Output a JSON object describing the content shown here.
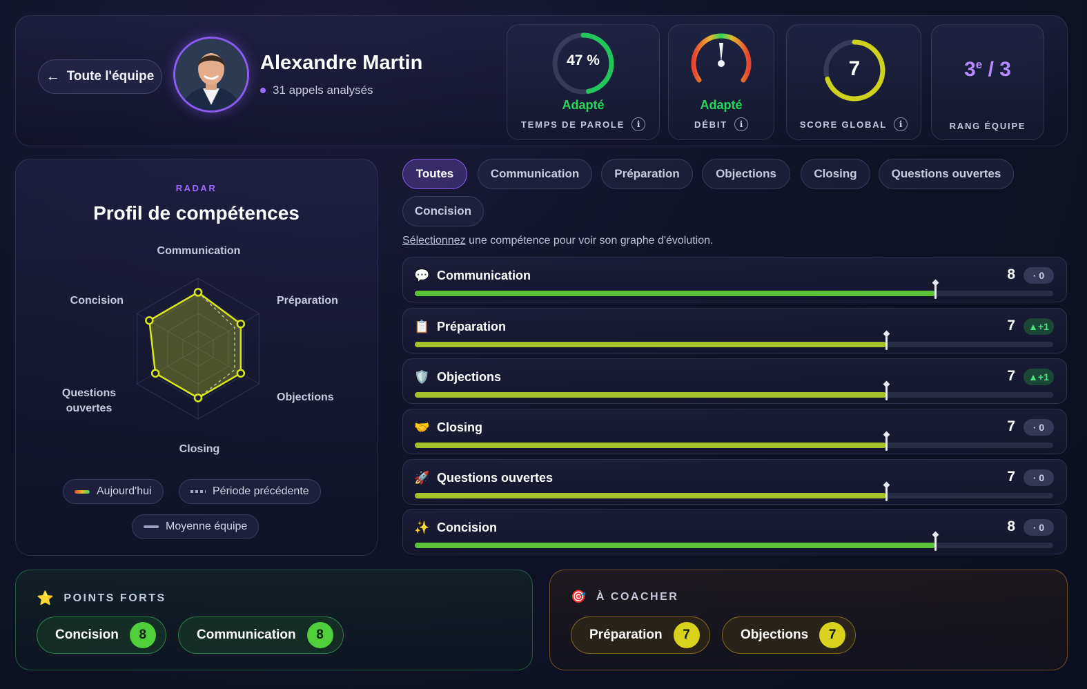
{
  "header": {
    "back_label": "Toute l'équipe",
    "name": "Alexandre Martin",
    "calls": "31 appels analysés"
  },
  "stats": {
    "talk_time": {
      "value": "47 %",
      "fraction": 0.47,
      "status": "Adapté",
      "label": "TEMPS DE PAROLE"
    },
    "debit": {
      "status": "Adapté",
      "label": "DÉBIT"
    },
    "score": {
      "value": "7",
      "fraction": 0.7,
      "label": "SCORE GLOBAL"
    },
    "rank": {
      "value": "3",
      "sup": "e",
      "total": "/ 3",
      "label": "RANG ÉQUIPE"
    }
  },
  "radar": {
    "kicker": "RADAR",
    "title": "Profil de compétences",
    "axes": [
      "Communication",
      "Préparation",
      "Objections",
      "Closing",
      "Questions ouvertes",
      "Concision"
    ],
    "today": [
      8,
      7,
      7,
      7,
      7,
      8
    ],
    "previous": [
      8,
      6,
      6,
      7,
      7,
      8
    ],
    "max": 10,
    "legend": {
      "today": "Aujourd'hui",
      "previous": "Période précédente",
      "team": "Moyenne équipe"
    }
  },
  "tabs": [
    "Toutes",
    "Communication",
    "Préparation",
    "Objections",
    "Closing",
    "Questions ouvertes",
    "Concision"
  ],
  "hint": {
    "pre": "Sélectionnez",
    "post": " une compétence pour voir son graphe d'évolution."
  },
  "skills": [
    {
      "icon": "💬",
      "name": "Communication",
      "score": "8",
      "delta": "· 0",
      "fill": 0.815,
      "color": "#5cc338"
    },
    {
      "icon": "📋",
      "name": "Préparation",
      "score": "7",
      "delta": "▲+1",
      "fill": 0.738,
      "color": "#a8c22a"
    },
    {
      "icon": "🛡️",
      "name": "Objections",
      "score": "7",
      "delta": "▲+1",
      "fill": 0.738,
      "color": "#a8c22a"
    },
    {
      "icon": "🤝",
      "name": "Closing",
      "score": "7",
      "delta": "· 0",
      "fill": 0.738,
      "color": "#a8c22a"
    },
    {
      "icon": "🚀",
      "name": "Questions ouvertes",
      "score": "7",
      "delta": "· 0",
      "fill": 0.738,
      "color": "#a8c22a"
    },
    {
      "icon": "✨",
      "name": "Concision",
      "score": "8",
      "delta": "· 0",
      "fill": 0.815,
      "color": "#5cc338"
    }
  ],
  "strengths": {
    "title": "POINTS FORTS",
    "items": [
      {
        "name": "Concision",
        "score": "8"
      },
      {
        "name": "Communication",
        "score": "8"
      }
    ]
  },
  "coach": {
    "title": "À COACHER",
    "items": [
      {
        "name": "Préparation",
        "score": "7"
      },
      {
        "name": "Objections",
        "score": "7"
      }
    ]
  },
  "colors": {
    "accent": "#8a5cf0",
    "good": "#27d65a",
    "lime": "#d8e81c"
  }
}
